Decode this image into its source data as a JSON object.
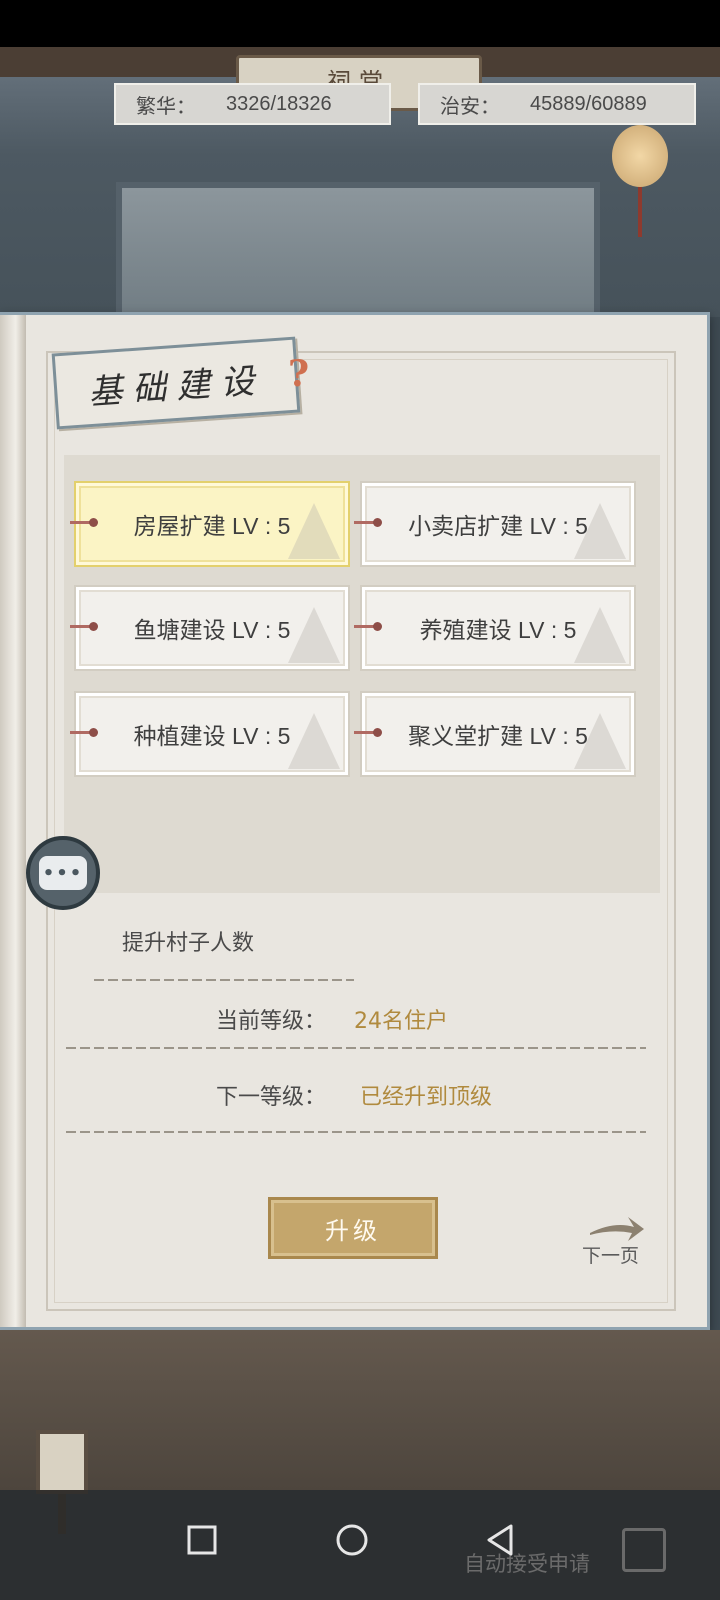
{
  "header": {
    "shrine_plaque": "祠堂",
    "prosperity": {
      "label": "繁华：",
      "value": "3326/18326"
    },
    "security": {
      "label": "治安：",
      "value": "45889/60889"
    }
  },
  "panel": {
    "title": "基础建设",
    "help_icon": "question-mark-icon",
    "buildings": [
      {
        "label": "房屋扩建 LV : 5",
        "selected": true
      },
      {
        "label": "小卖店扩建 LV : 5",
        "selected": false
      },
      {
        "label": "鱼塘建设 LV : 5",
        "selected": false
      },
      {
        "label": "养殖建设 LV : 5",
        "selected": false
      },
      {
        "label": "种植建设 LV : 5",
        "selected": false
      },
      {
        "label": "聚义堂扩建 LV : 5",
        "selected": false
      }
    ],
    "detail": {
      "description": "提升村子人数",
      "current_level_label": "当前等级：",
      "current_level_value": "24名住户",
      "next_level_label": "下一等级：",
      "next_level_value": "已经升到顶级"
    },
    "upgrade_button": "升级",
    "next_page": "下一页"
  },
  "bottom": {
    "auto_accept": "自动接受申请"
  },
  "colors": {
    "accent_gold": "#b08a3e",
    "selected_cell": "#fbf4c5",
    "button": "#c4a66c"
  }
}
